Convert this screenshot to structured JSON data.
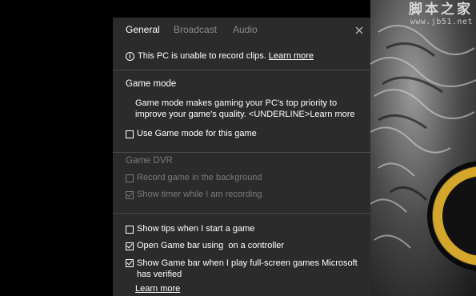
{
  "tabs": [
    {
      "label": "General",
      "active": true
    },
    {
      "label": "Broadcast",
      "active": false
    },
    {
      "label": "Audio",
      "active": false
    }
  ],
  "info": {
    "icon": "info-icon",
    "text": "This PC is unable to record clips. ",
    "link": "Learn more"
  },
  "game_mode": {
    "title": "Game mode",
    "description": "Game mode makes gaming your PC's top priority to improve your game's quality. <UNDERLINE>Learn more",
    "checkbox": {
      "label": "Use Game mode for this game",
      "checked": false
    }
  },
  "game_dvr": {
    "title": "Game DVR",
    "options": [
      {
        "label": "Record game in the background",
        "checked": false,
        "disabled": true
      },
      {
        "label": "Show timer while I am recording",
        "checked": true,
        "disabled": true
      }
    ]
  },
  "general_options": [
    {
      "label": "Show tips when I start a game",
      "checked": false
    },
    {
      "label": "Open Game bar using  on a controller",
      "checked": true
    },
    {
      "label": "Show Game bar when I play full-screen games Microsoft has verified",
      "checked": true
    }
  ],
  "bottom_link": "Learn more",
  "watermark": {
    "chinese": "脚本之家",
    "url": "www.jb51.net"
  },
  "colors": {
    "panel_bg": "#2b2b2b",
    "text": "#ffffff",
    "disabled_text": "#7a7a7a",
    "inactive_tab": "#8a8a8a",
    "divider": "#4a4a4a"
  }
}
